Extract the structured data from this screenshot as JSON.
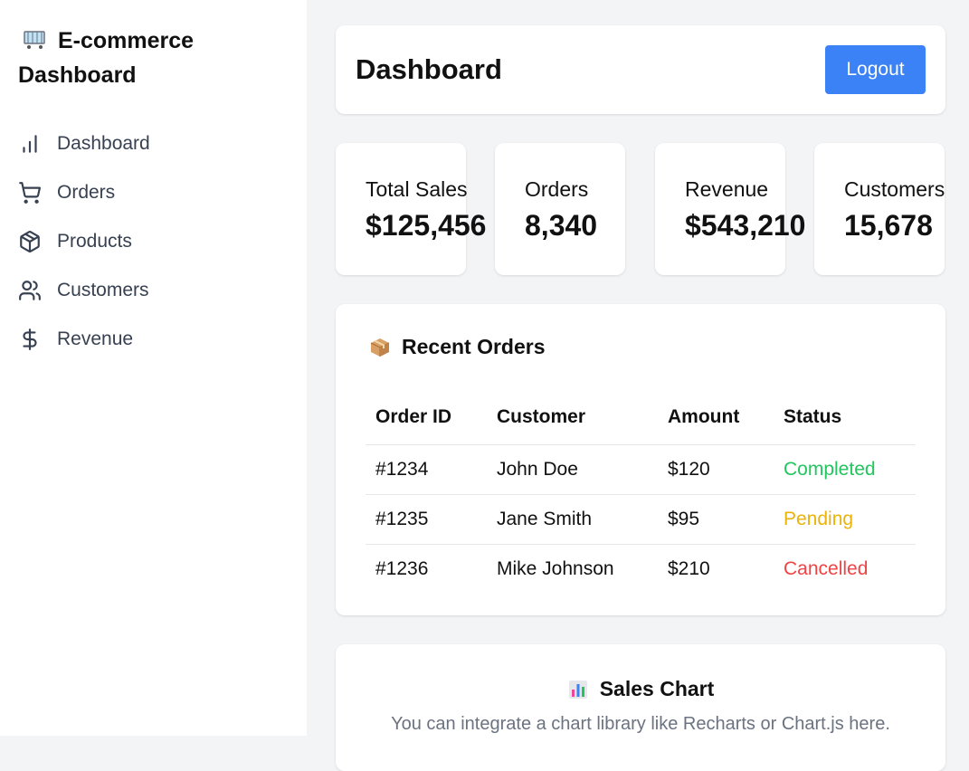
{
  "brand": {
    "line1": "E-commerce",
    "line2": "Dashboard",
    "icon": "shopping-cart-emoji"
  },
  "nav": [
    {
      "label": "Dashboard",
      "icon": "bar-chart-icon"
    },
    {
      "label": "Orders",
      "icon": "shopping-cart-icon"
    },
    {
      "label": "Products",
      "icon": "package-icon"
    },
    {
      "label": "Customers",
      "icon": "users-icon"
    },
    {
      "label": "Revenue",
      "icon": "dollar-icon"
    }
  ],
  "header": {
    "title": "Dashboard",
    "logout_label": "Logout"
  },
  "stats": [
    {
      "label": "Total Sales",
      "value": "$125,456"
    },
    {
      "label": "Orders",
      "value": "8,340"
    },
    {
      "label": "Revenue",
      "value": "$543,210"
    },
    {
      "label": "Customers",
      "value": "15,678"
    }
  ],
  "orders": {
    "title": "Recent Orders",
    "columns": [
      "Order ID",
      "Customer",
      "Amount",
      "Status"
    ],
    "rows": [
      {
        "id": "#1234",
        "customer": "John Doe",
        "amount": "$120",
        "status": "Completed",
        "status_color": "#22c55e"
      },
      {
        "id": "#1235",
        "customer": "Jane Smith",
        "amount": "$95",
        "status": "Pending",
        "status_color": "#eab308"
      },
      {
        "id": "#1236",
        "customer": "Mike Johnson",
        "amount": "$210",
        "status": "Cancelled",
        "status_color": "#ef4444"
      }
    ]
  },
  "chart": {
    "title": "Sales Chart",
    "subtitle": "You can integrate a chart library like Recharts or Chart.js here."
  },
  "colors": {
    "accent": "#3b82f6"
  }
}
